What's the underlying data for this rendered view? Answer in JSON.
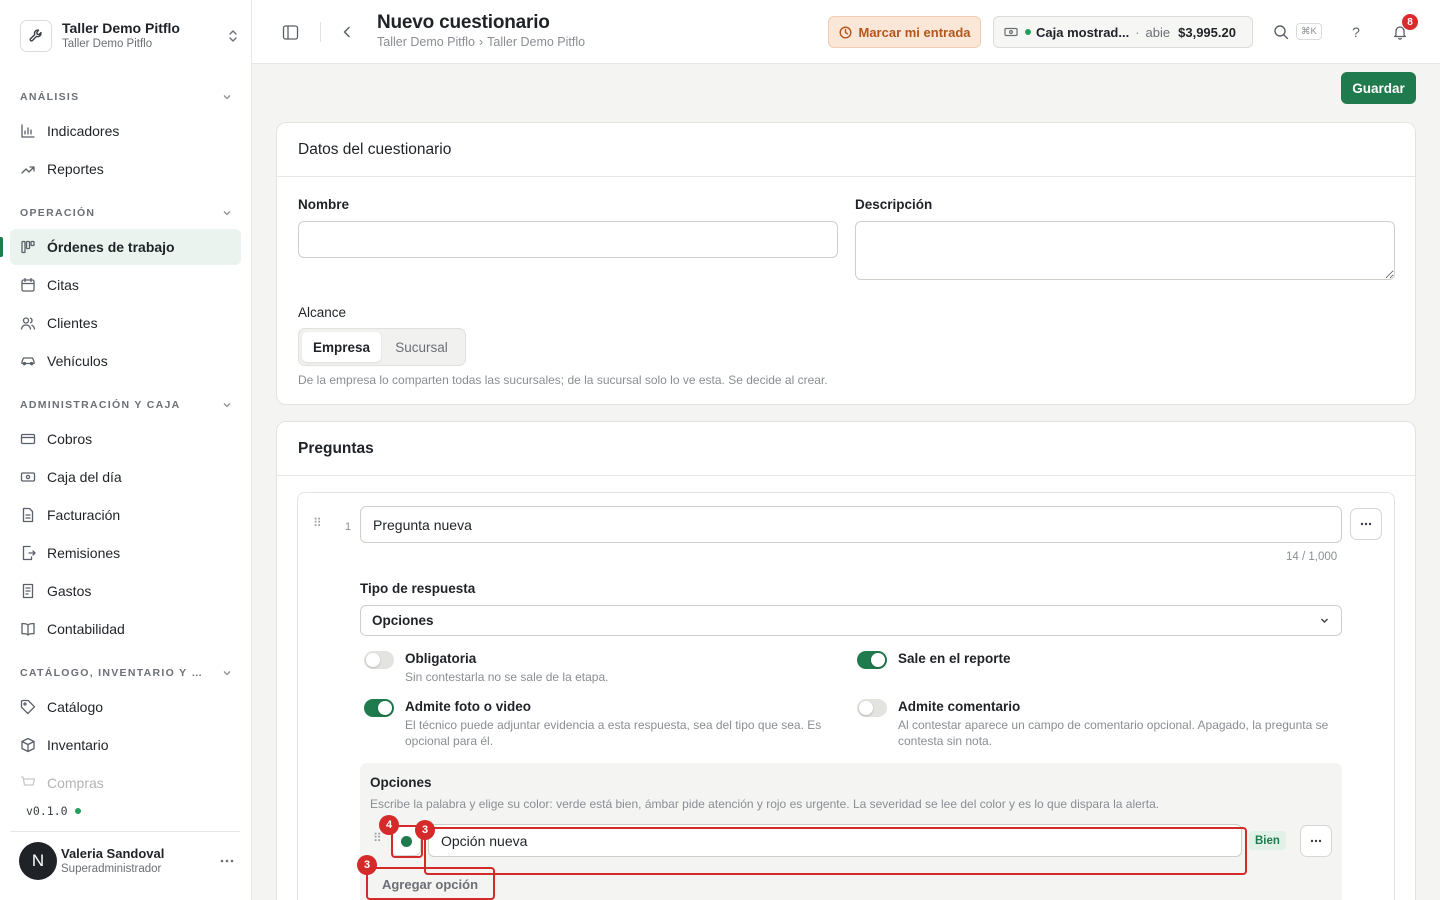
{
  "org": {
    "name": "Taller Demo Pitflo",
    "branch": "Taller Demo Pitflo"
  },
  "sidebar": {
    "sections": [
      {
        "title": "ANÁLISIS",
        "items": [
          {
            "label": "Indicadores",
            "icon": "bar-chart-icon"
          },
          {
            "label": "Reportes",
            "icon": "trend-line-icon"
          }
        ]
      },
      {
        "title": "OPERACIÓN",
        "items": [
          {
            "label": "Órdenes de trabajo",
            "icon": "kanban-icon",
            "active": true
          },
          {
            "label": "Citas",
            "icon": "calendar-icon"
          },
          {
            "label": "Clientes",
            "icon": "users-icon"
          },
          {
            "label": "Vehículos",
            "icon": "car-icon"
          }
        ]
      },
      {
        "title": "ADMINISTRACIÓN Y CAJA",
        "items": [
          {
            "label": "Cobros",
            "icon": "credit-card-icon"
          },
          {
            "label": "Caja del día",
            "icon": "cash-icon"
          },
          {
            "label": "Facturación",
            "icon": "file-icon"
          },
          {
            "label": "Remisiones",
            "icon": "file-export-icon"
          },
          {
            "label": "Gastos",
            "icon": "receipt-icon"
          },
          {
            "label": "Contabilidad",
            "icon": "book-icon"
          }
        ]
      },
      {
        "title": "CATÁLOGO, INVENTARIO Y CO...",
        "items": [
          {
            "label": "Catálogo",
            "icon": "tag-icon"
          },
          {
            "label": "Inventario",
            "icon": "box-icon"
          },
          {
            "label": "Compras",
            "icon": "cart-icon"
          }
        ]
      }
    ],
    "version": "v0.1.0",
    "user": {
      "initial": "N",
      "name": "Valeria Sandoval",
      "role": "Superadministrador"
    }
  },
  "header": {
    "title": "Nuevo cuestionario",
    "breadcrumb": [
      "Taller Demo Pitflo",
      "Taller Demo Pitflo"
    ],
    "clock_in_label": "Marcar mi entrada",
    "register": {
      "name": "Caja mostrad...",
      "separator": "·",
      "status": "abie",
      "amount": "$3,995.20"
    },
    "shortcut": "⌘K",
    "help": "?",
    "notifications_count": "8"
  },
  "toolbar": {
    "save_label": "Guardar"
  },
  "form": {
    "section_title": "Datos del cuestionario",
    "name_label": "Nombre",
    "name_value": "",
    "description_label": "Descripción",
    "description_value": "",
    "scope_label": "Alcance",
    "scope_options": [
      "Empresa",
      "Sucursal"
    ],
    "scope_selected": "Empresa",
    "scope_help": "De la empresa lo comparten todas las sucursales; de la sucursal solo lo ve esta. Se decide al crear."
  },
  "questions": {
    "section_title": "Preguntas",
    "items": [
      {
        "number": "1",
        "text": "Pregunta nueva",
        "counter": "14 / 1,000",
        "answer_type_label": "Tipo de respuesta",
        "answer_type": "Opciones",
        "toggles": [
          {
            "title": "Obligatoria",
            "desc": "Sin contestarla no se sale de la etapa.",
            "on": false
          },
          {
            "title": "Sale en el reporte",
            "desc": "",
            "on": true
          },
          {
            "title": "Admite foto o video",
            "desc": "El técnico puede adjuntar evidencia a esta respuesta, sea del tipo que sea. Es opcional para él.",
            "on": true
          },
          {
            "title": "Admite comentario",
            "desc": "Al contestar aparece un campo de comentario opcional. Apagado, la pregunta se contesta sin nota.",
            "on": false
          }
        ],
        "options_title": "Opciones",
        "options_help": "Escribe la palabra y elige su color: verde está bien, ámbar pide atención y rojo es urgente. La severidad se lee del color y es lo que dispara la alerta.",
        "options": [
          {
            "label": "Opción nueva",
            "color": "#1f7a4d",
            "severity": "Bien"
          }
        ],
        "add_option_label": "Agregar opción"
      }
    ]
  },
  "annotations": [
    "4",
    "3",
    "3"
  ],
  "colors": {
    "accent": "#1f7a4d",
    "warning_bg": "#fbe7d8",
    "warning_text": "#b4561b",
    "danger": "#d42a2a"
  }
}
